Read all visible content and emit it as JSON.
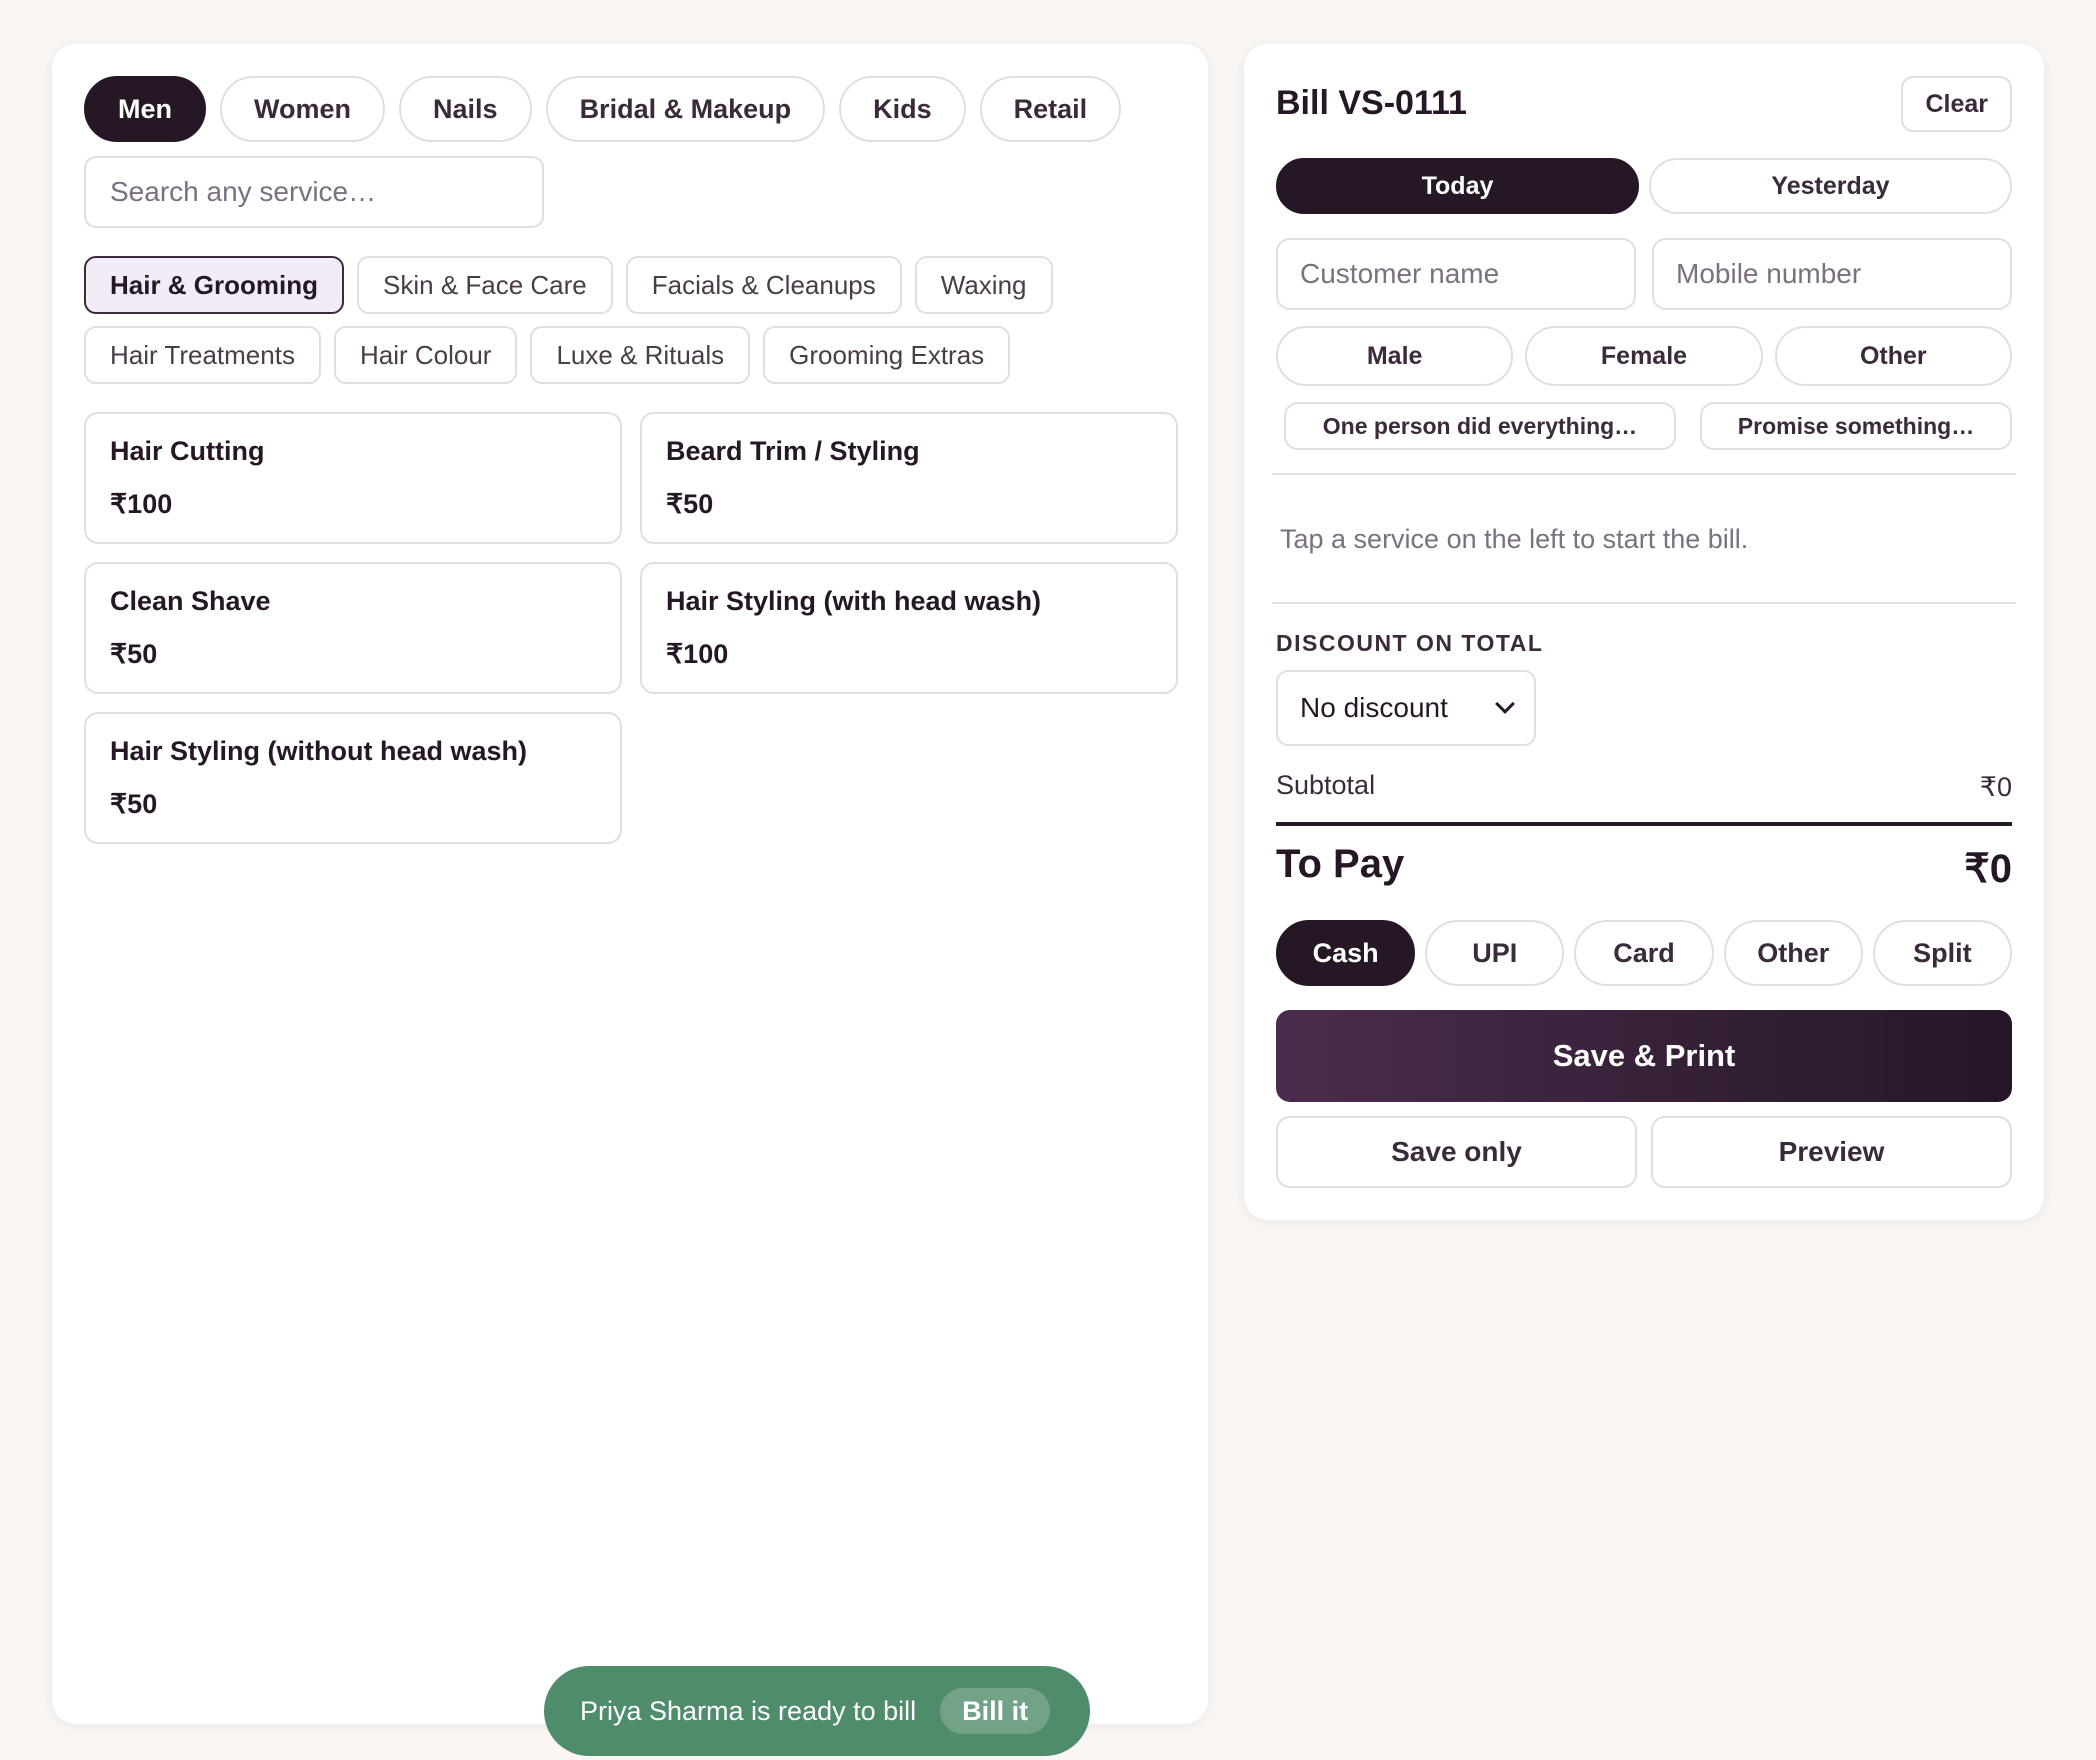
{
  "catalog": {
    "top_tabs": [
      {
        "label": "Men",
        "active": true
      },
      {
        "label": "Women",
        "active": false
      },
      {
        "label": "Nails",
        "active": false
      },
      {
        "label": "Bridal & Makeup",
        "active": false
      },
      {
        "label": "Kids",
        "active": false
      },
      {
        "label": "Retail",
        "active": false
      }
    ],
    "search": {
      "placeholder": "Search any service…",
      "value": ""
    },
    "subcategories": [
      {
        "label": "Hair & Grooming",
        "active": true
      },
      {
        "label": "Skin & Face Care",
        "active": false
      },
      {
        "label": "Facials & Cleanups",
        "active": false
      },
      {
        "label": "Waxing",
        "active": false
      },
      {
        "label": "Hair Treatments",
        "active": false
      },
      {
        "label": "Hair Colour",
        "active": false
      },
      {
        "label": "Luxe & Rituals",
        "active": false
      },
      {
        "label": "Grooming Extras",
        "active": false
      }
    ],
    "services": [
      {
        "name": "Hair Cutting",
        "price": "₹100"
      },
      {
        "name": "Beard Trim / Styling",
        "price": "₹50"
      },
      {
        "name": "Clean Shave",
        "price": "₹50"
      },
      {
        "name": "Hair Styling (with head wash)",
        "price": "₹100"
      },
      {
        "name": "Hair Styling (without head wash)",
        "price": "₹50"
      }
    ]
  },
  "toast": {
    "message": "Priya Sharma is ready to bill",
    "action_label": "Bill it",
    "color": "#4f8c6c"
  },
  "bill": {
    "title": "Bill VS-0111",
    "clear_label": "Clear",
    "day_options": [
      {
        "label": "Today",
        "active": true
      },
      {
        "label": "Yesterday",
        "active": false
      }
    ],
    "customer_name": {
      "placeholder": "Customer name",
      "value": ""
    },
    "mobile": {
      "placeholder": "Mobile number",
      "value": ""
    },
    "gender_options": [
      "Male",
      "Female",
      "Other"
    ],
    "notes": [
      "One person did everything…",
      "Promise something…"
    ],
    "empty_message": "Tap a service on the left to start the bill.",
    "discount": {
      "label": "DISCOUNT ON TOTAL",
      "selected": "No discount"
    },
    "subtotal": {
      "label": "Subtotal",
      "value": "₹0"
    },
    "to_pay": {
      "label": "To Pay",
      "value": "₹0"
    },
    "payment_methods": [
      {
        "label": "Cash",
        "active": true
      },
      {
        "label": "UPI",
        "active": false
      },
      {
        "label": "Card",
        "active": false
      },
      {
        "label": "Other",
        "active": false
      },
      {
        "label": "Split",
        "active": false
      }
    ],
    "save_print_label": "Save & Print",
    "save_only_label": "Save only",
    "preview_label": "Preview"
  },
  "colors": {
    "accent_dark": "#261726",
    "page_background": "#f8f5f2",
    "toast_green": "#4f8c6c"
  }
}
